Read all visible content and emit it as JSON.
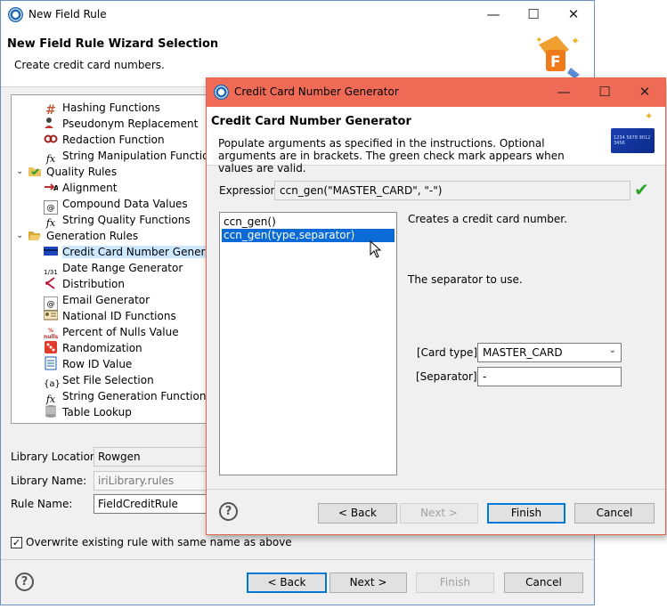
{
  "back_window": {
    "title": "New Field Rule",
    "heading": "New Field Rule Wizard Selection",
    "description": "Create credit card numbers.",
    "tree": [
      {
        "label": "Hashing Functions",
        "icon": "hash-icon"
      },
      {
        "label": "Pseudonym Replacement",
        "icon": "pseudonym-icon"
      },
      {
        "label": "Redaction Function",
        "icon": "redaction-icon"
      },
      {
        "label": "String Manipulation Functions",
        "icon": "fx-icon"
      },
      {
        "label": "Quality Rules",
        "icon": "folder-check-icon"
      },
      {
        "label": "Alignment",
        "icon": "alignment-icon"
      },
      {
        "label": "Compound Data Values",
        "icon": "compound-icon"
      },
      {
        "label": "String Quality Functions",
        "icon": "fx-icon"
      },
      {
        "label": "Generation Rules",
        "icon": "folder-open-icon"
      },
      {
        "label": "Credit Card Number Generator",
        "icon": "credit-card-icon"
      },
      {
        "label": "Date Range Generator",
        "icon": "date-range-icon"
      },
      {
        "label": "Distribution",
        "icon": "distribution-icon"
      },
      {
        "label": "Email Generator",
        "icon": "email-icon"
      },
      {
        "label": "National ID Functions",
        "icon": "id-card-icon"
      },
      {
        "label": "Percent of Nulls Value",
        "icon": "percent-nulls-icon"
      },
      {
        "label": "Randomization",
        "icon": "random-icon"
      },
      {
        "label": "Row ID Value",
        "icon": "row-id-icon"
      },
      {
        "label": "Set File Selection",
        "icon": "set-braces-icon"
      },
      {
        "label": "String Generation Functions",
        "icon": "fx-icon"
      },
      {
        "label": "Table Lookup",
        "icon": "database-icon"
      }
    ],
    "icon_glyphs": {
      "hash": "#",
      "fx": "fx",
      "nulls_top": "%",
      "nulls_bottom": "nulls",
      "date": "1/31",
      "at": "@",
      "braces": "{a}"
    },
    "library_location": {
      "label": "Library Location:",
      "value": "Rowgen"
    },
    "library_name": {
      "label": "Library Name:",
      "value": "iriLibrary.rules"
    },
    "rule_name": {
      "label": "Rule Name:",
      "value": "FieldCreditRule"
    },
    "overwrite": {
      "label": "Overwrite existing rule with same name as above",
      "checked": true
    },
    "buttons": {
      "back": "< Back",
      "next": "Next >",
      "finish": "Finish",
      "cancel": "Cancel"
    }
  },
  "front_window": {
    "title": "Credit Card Number Generator",
    "heading": "Credit Card Number Generator",
    "description": "Populate arguments as specified in the instructions. Optional arguments are in brackets. The green check mark appears when values are valid.",
    "card_text": "1234 5678 9012 3456",
    "expression_label": "Expression:",
    "expression_value": "ccn_gen(\"MASTER_CARD\", \"-\")",
    "functions": [
      "ccn_gen()",
      "ccn_gen(type,separator)"
    ],
    "selected_function": 1,
    "function_description": "Creates a credit card number.",
    "separator_description": "The separator to use.",
    "args": {
      "card_type": {
        "label": "[Card type]:",
        "value": "MASTER_CARD"
      },
      "separator": {
        "label": "[Separator]:",
        "value": "-"
      }
    },
    "buttons": {
      "back": "< Back",
      "next": "Next >",
      "finish": "Finish",
      "cancel": "Cancel"
    }
  },
  "window_controls": {
    "minimize": "—",
    "maximize": "☐",
    "close": "✕"
  },
  "colors": {
    "front_titlebar": "#ef6b55",
    "selection": "#0a6ad6",
    "valid_check": "#2aa22a"
  }
}
